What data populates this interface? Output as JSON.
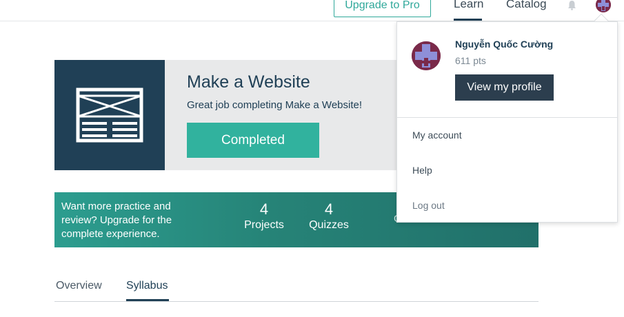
{
  "nav": {
    "upgrade_label": "Upgrade to Pro",
    "learn_label": "Learn",
    "catalog_label": "Catalog"
  },
  "course": {
    "title": "Make a Website",
    "subtitle": "Great job completing Make a Website!",
    "completed_label": "Completed"
  },
  "promo": {
    "text": "Want more practice and review? Upgrade for the complete experience.",
    "projects_count": "4",
    "projects_label": "Projects",
    "quizzes_count": "4",
    "quizzes_label": "Quizzes",
    "cta_partial": "Get Instant Access"
  },
  "tabs": {
    "overview_label": "Overview",
    "syllabus_label": "Syllabus"
  },
  "user_menu": {
    "name": "Nguyễn Quốc Cường",
    "points": "611 pts",
    "profile_button": "View my profile",
    "items": [
      {
        "label": "My account"
      },
      {
        "label": "Help"
      },
      {
        "label": "Log out"
      }
    ]
  },
  "colors": {
    "brand_dark": "#204056",
    "accent_teal": "#31b29e",
    "avatar": "#7a2a4a"
  }
}
